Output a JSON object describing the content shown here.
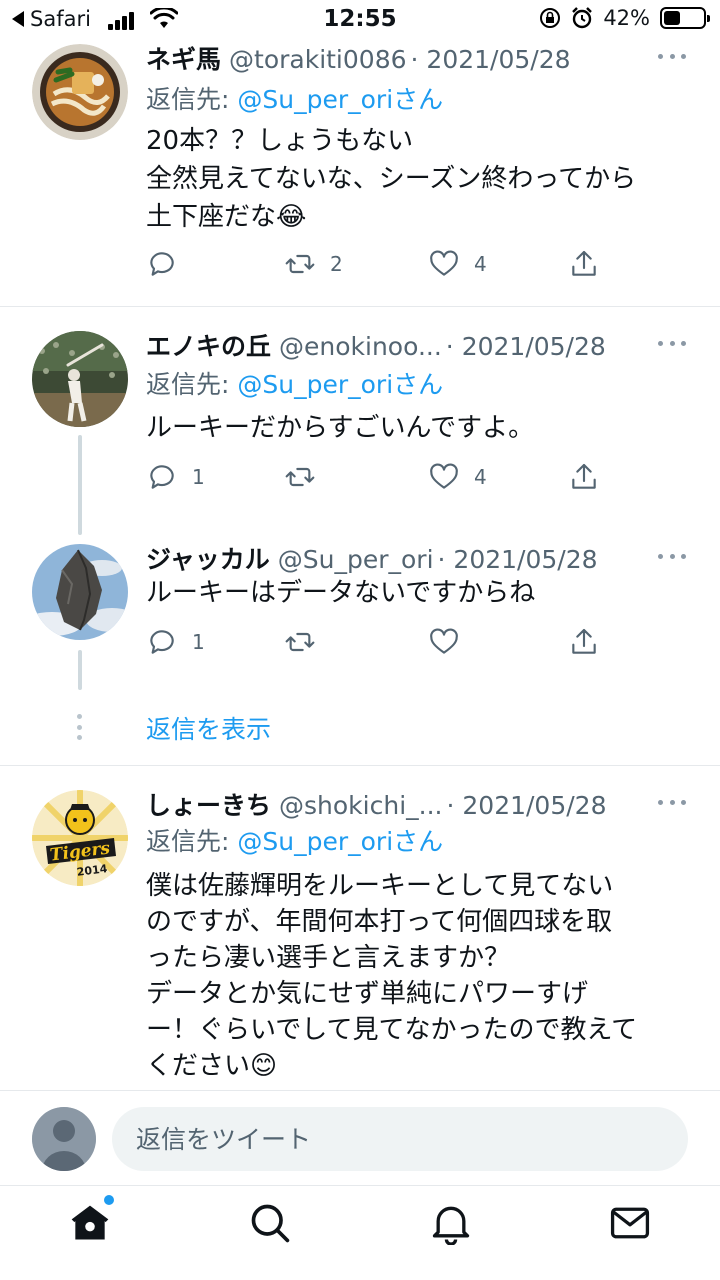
{
  "status_bar": {
    "back_app": "Safari",
    "time": "12:55",
    "battery": "42%",
    "battery_level": 0.42
  },
  "colors": {
    "accent": "#1d9bf0",
    "muted": "#536471",
    "divider": "#e6e9ec"
  },
  "tweets": [
    {
      "name": "ネギ馬",
      "handle": "@torakiti0086",
      "date": "· 2021/05/28",
      "reply_label": "返信先:",
      "reply_to": "@Su_per_oriさん",
      "lines": [
        "20本？？しょうもない",
        "全然見えてないな、シーズン終わってから",
        "土下座だな😂"
      ],
      "reply_count": "",
      "retweet_count": "2",
      "like_count": "4",
      "avatar": "udon-avatar"
    },
    {
      "name": "エノキの丘",
      "handle": "@enokinoo...",
      "date": "· 2021/05/28",
      "reply_label": "返信先:",
      "reply_to": "@Su_per_oriさん",
      "lines": [
        "ルーキーだからすごいんですよ。"
      ],
      "reply_count": "1",
      "retweet_count": "",
      "like_count": "4",
      "avatar": "baseball-player-avatar"
    },
    {
      "name": "ジャッカル",
      "handle": "@Su_per_ori",
      "date": "· 2021/05/28",
      "lines": [
        "ルーキーはデータないですからね"
      ],
      "reply_count": "1",
      "retweet_count": "",
      "like_count": "",
      "avatar": "rock-avatar"
    },
    {
      "name": "しょーきち",
      "handle": "@shokichi_...",
      "date": "· 2021/05/28",
      "reply_label": "返信先:",
      "reply_to": "@Su_per_oriさん",
      "lines": [
        "僕は佐藤輝明をルーキーとして見てない",
        "のですが、年間何本打って何個四球を取",
        "ったら凄い選手と言えますか？",
        "データとか気にせず単純にパワーすげ",
        "ー！ぐらいでして見てなかったので教えて",
        "ください😊"
      ],
      "avatar": "tigers-avatar",
      "avatar_text": "Tigers",
      "avatar_year": "2014"
    }
  ],
  "show_replies": "返信を表示",
  "composer": {
    "placeholder": "返信をツイート"
  },
  "tabbar": {
    "items": [
      "home-icon",
      "search-icon",
      "notifications-icon",
      "messages-icon"
    ],
    "home_badge": true
  }
}
